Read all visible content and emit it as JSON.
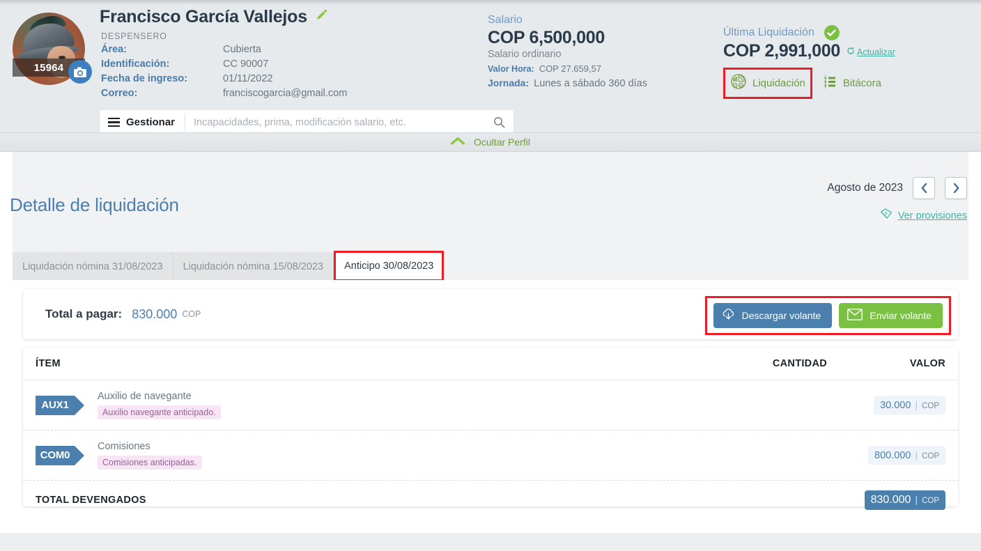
{
  "profile": {
    "employee_id": "15964",
    "name": "Francisco García Vallejos",
    "role": "DESPENSERO",
    "facts": [
      {
        "label": "Área:",
        "value": "Cubierta"
      },
      {
        "label": "Identificación:",
        "value": "CC 90007"
      },
      {
        "label": "Fecha de ingreso:",
        "value": "01/11/2022"
      },
      {
        "label": "Correo:",
        "value": "franciscogarcia@gmail.com"
      }
    ],
    "edit_icon": "pencil-icon",
    "camera_icon": "camera-icon"
  },
  "search": {
    "manage_label": "Gestionar",
    "placeholder": "Incapacidades, prima, modificación salario, etc.",
    "value": "",
    "search_icon": "search-icon",
    "menu_icon": "hamburger-icon"
  },
  "salary": {
    "title": "Salario",
    "amount": "COP 6,500,000",
    "subtitle": "Salario ordinario",
    "hour_label": "Valor Hora:",
    "hour_value": "COP 27.659,57",
    "journey_label": "Jornada:",
    "journey_value": "Lunes a sábado 360 días"
  },
  "last_settlement": {
    "title": "Última Liquidación",
    "amount": "COP 2,991,000",
    "status_icon": "check-circle-icon",
    "update_label": "Actualizar",
    "update_icon": "refresh-icon",
    "settlement_label": "Liquidación",
    "settlement_icon": "pie-chart-money-icon",
    "log_label": "Bitácora",
    "log_icon": "list-icon"
  },
  "collapse": {
    "label": "Ocultar Perfil",
    "icon": "chevron-up-icon"
  },
  "detail": {
    "page_title": "Detalle de liquidación",
    "period": "Agosto de 2023",
    "prev_icon": "chevron-left-icon",
    "next_icon": "chevron-right-icon",
    "provisions_label": "Ver provisiones",
    "provisions_icon": "money-note-icon",
    "tabs": [
      {
        "label": "Liquidación nómina 31/08/2023",
        "active": false
      },
      {
        "label": "Liquidación nómina 15/08/2023",
        "active": false
      },
      {
        "label": "Anticipo 30/08/2023",
        "active": true
      }
    ],
    "total_label": "Total a pagar:",
    "total_amount": "830.000",
    "total_currency": "COP",
    "download_label": "Descargar volante",
    "download_icon": "cloud-download-icon",
    "send_label": "Enviar volante",
    "send_icon": "envelope-icon",
    "columns": {
      "item": "ÍTEM",
      "quantity": "CANTIDAD",
      "value": "VALOR"
    },
    "rows": [
      {
        "code": "AUX1",
        "name": "Auxilio de navegante",
        "note": "Auxilio navegante anticipado.",
        "quantity": "",
        "value": "30.000",
        "currency": "COP"
      },
      {
        "code": "COM0",
        "name": "Comisiones",
        "note": "Comisiones anticipadas.",
        "quantity": "",
        "value": "800.000",
        "currency": "COP"
      }
    ],
    "total_row": {
      "label": "TOTAL DEVENGADOS",
      "value": "830.000",
      "currency": "COP"
    }
  },
  "colors": {
    "brand_blue": "#4a7fae",
    "green": "#7ac143",
    "teal": "#3fb3a6",
    "highlight_red": "#ee1c24",
    "header_bg": "#e6eaec",
    "note_pink": "#f7e4f5"
  }
}
